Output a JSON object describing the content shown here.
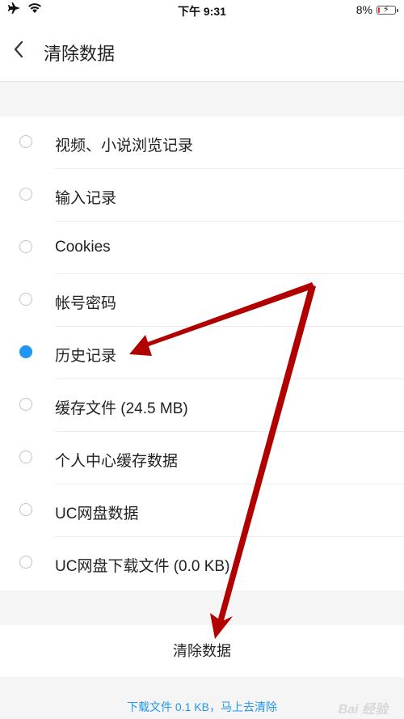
{
  "status_bar": {
    "time": "下午 9:31",
    "battery_text": "8%",
    "battery_level": 0.08,
    "icons": [
      "airplane-icon",
      "wifi-icon",
      "battery-icon"
    ]
  },
  "nav": {
    "back_icon": "chevron-left-icon",
    "title": "清除数据"
  },
  "options": [
    {
      "label": "视频、小说浏览记录",
      "checked": false
    },
    {
      "label": "输入记录",
      "checked": false
    },
    {
      "label": "Cookies",
      "checked": false
    },
    {
      "label": "帐号密码",
      "checked": false
    },
    {
      "label": "历史记录",
      "checked": true
    },
    {
      "label": "缓存文件 (24.5 MB)",
      "checked": false
    },
    {
      "label": "个人中心缓存数据",
      "checked": false
    },
    {
      "label": "UC网盘数据",
      "checked": false
    },
    {
      "label": "UC网盘下载文件 (0.0 KB)",
      "checked": false
    }
  ],
  "clear_button_label": "清除数据",
  "download_hint": "下载文件 0.1 KB，马上去清除",
  "watermark": "Bai 经验",
  "colors": {
    "accent": "#2196f3",
    "annotation_arrow": "#b00000",
    "battery_low": "#e53935"
  }
}
